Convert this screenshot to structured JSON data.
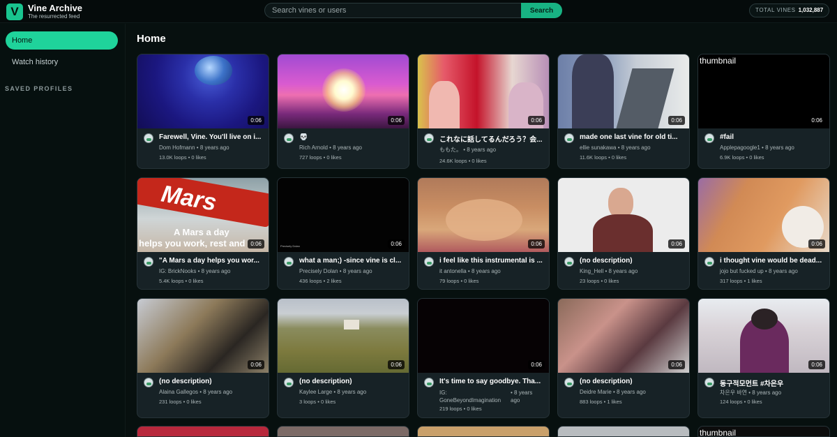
{
  "header": {
    "logo_letter": "V",
    "title": "Vine Archive",
    "subtitle": "The resurrected feed",
    "search_placeholder": "Search vines or users",
    "search_button": "Search",
    "total_label": "TOTAL VINES",
    "total_value": "1,032,887"
  },
  "sidebar": {
    "home": "Home",
    "watch_history": "Watch history",
    "saved_profiles": "SAVED PROFILES"
  },
  "main": {
    "title": "Home",
    "thumb_alt": "thumbnail",
    "cards": [
      {
        "title": "Farewell, Vine. You'll live on i...",
        "author": "Dom Hofmann",
        "age": "8 years ago",
        "loops": "13.0K loops",
        "likes": "0 likes",
        "duration": "0:06",
        "thumb": "earth"
      },
      {
        "title": "💀",
        "author": "Rich Arnold",
        "age": "8 years ago",
        "loops": "727 loops",
        "likes": "0 likes",
        "duration": "0:06",
        "thumb": "sun"
      },
      {
        "title": "これなに話してるんだろう？会...",
        "author": "ももた。",
        "age": "8 years ago",
        "loops": "24.6K loops",
        "likes": "0 likes",
        "duration": "0:06",
        "thumb": "party"
      },
      {
        "title": "made one last vine for old ti...",
        "author": "ellie sunakawa",
        "age": "8 years ago",
        "loops": "11.6K loops",
        "likes": "0 likes",
        "duration": "0:06",
        "thumb": "car"
      },
      {
        "title": "#fail",
        "author": "Applepagoogle1",
        "age": "8 years ago",
        "loops": "6.9K loops",
        "likes": "0 likes",
        "duration": "0:06",
        "thumb": "broken"
      },
      {
        "title": "\"A Mars a day helps you wor...",
        "author": "IG: BrickNooks",
        "age": "8 years ago",
        "loops": "5.4K loops",
        "likes": "0 likes",
        "duration": "0:06",
        "thumb": "mars",
        "thumb_text_1": "Mars",
        "thumb_text_2": "A Mars a day",
        "thumb_text_3": "helps you work, rest and"
      },
      {
        "title": "what a man;) -since vine is cl...",
        "author": "Precisely Dolan",
        "age": "8 years ago",
        "loops": "436 loops",
        "likes": "2 likes",
        "duration": "0:06",
        "thumb": "dark",
        "thumb_text_1": "Precisely Dolan"
      },
      {
        "title": "i feel like this instrumental is ...",
        "author": "it antonella",
        "age": "8 years ago",
        "loops": "79 loops",
        "likes": "0 likes",
        "duration": "0:06",
        "thumb": "cat"
      },
      {
        "title": "(no description)",
        "author": "King_Hell",
        "age": "8 years ago",
        "loops": "23 loops",
        "likes": "0 likes",
        "duration": "0:06",
        "thumb": "man"
      },
      {
        "title": "i thought vine would be dead...",
        "author": "jojo but fucked up",
        "age": "8 years ago",
        "loops": "317 loops",
        "likes": "1 likes",
        "duration": "0:06",
        "thumb": "cat2"
      },
      {
        "title": "(no description)",
        "author": "Alaina Gallegos",
        "age": "8 years ago",
        "loops": "231 loops",
        "likes": "0 likes",
        "duration": "0:06",
        "thumb": "closeup"
      },
      {
        "title": "(no description)",
        "author": "Kaylee Large",
        "age": "8 years ago",
        "loops": "3 loops",
        "likes": "0 likes",
        "duration": "0:06",
        "thumb": "field"
      },
      {
        "title": "It's time to say goodbye. Tha...",
        "author": "IG: GoneBeyondImagination",
        "age": "8 years ago",
        "loops": "219 loops",
        "likes": "0 likes",
        "duration": "0:06",
        "thumb": "black"
      },
      {
        "title": "(no description)",
        "author": "Deidre Marie",
        "age": "8 years ago",
        "loops": "883 loops",
        "likes": "1 likes",
        "duration": "0:06",
        "thumb": "face"
      },
      {
        "title": "동구적모먼트 #차은우",
        "author": "차은우 바연",
        "age": "8 years ago",
        "loops": "124 loops",
        "likes": "0 likes",
        "duration": "0:06",
        "thumb": "person"
      }
    ]
  },
  "colors": {
    "accent": "#1fd39b",
    "background": "#07100f",
    "card": "#172226"
  }
}
